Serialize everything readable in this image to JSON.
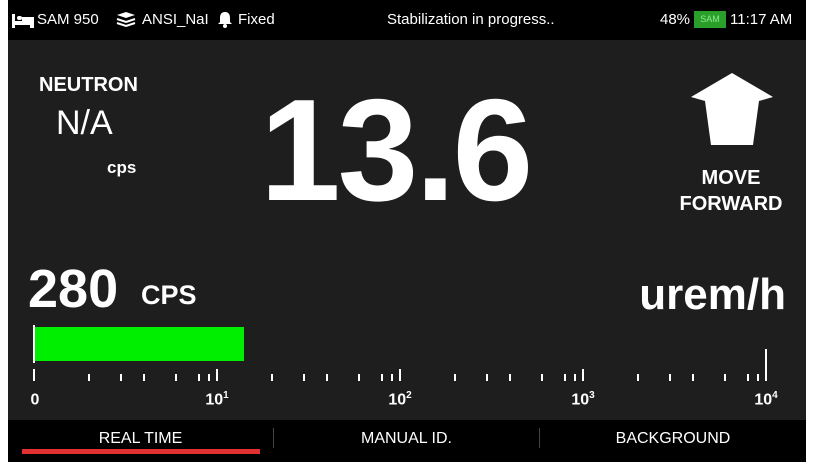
{
  "status": {
    "device": "SAM 950",
    "library": "ANSI_NaI",
    "mode": "Fixed",
    "message": "Stabilization in progress..",
    "battery_percent": "48%",
    "battery_label": "SAM",
    "time": "11:17 AM",
    "icons": [
      "bed-icon",
      "library-stack-icon",
      "bell-icon",
      "battery-icon"
    ]
  },
  "neutron": {
    "title": "NEUTRON",
    "value": "N/A",
    "unit": "cps"
  },
  "dose": {
    "value": "13.6",
    "unit": "urem/h"
  },
  "direction": {
    "icon": "arrow-up-icon",
    "line1": "MOVE",
    "line2": "FORWARD"
  },
  "gamma": {
    "value": "280",
    "unit": "CPS",
    "bar_fraction": 0.285,
    "bar_color": "#00ee00"
  },
  "scale": {
    "labels": [
      {
        "text": "0",
        "sup": ""
      },
      {
        "text": "10",
        "sup": "1"
      },
      {
        "text": "10",
        "sup": "2"
      },
      {
        "text": "10",
        "sup": "3"
      },
      {
        "text": "10",
        "sup": "4"
      }
    ]
  },
  "nav": {
    "tabs": [
      "REAL TIME",
      "MANUAL ID.",
      "BACKGROUND"
    ],
    "active_index": 0,
    "active_color": "#e03030"
  }
}
